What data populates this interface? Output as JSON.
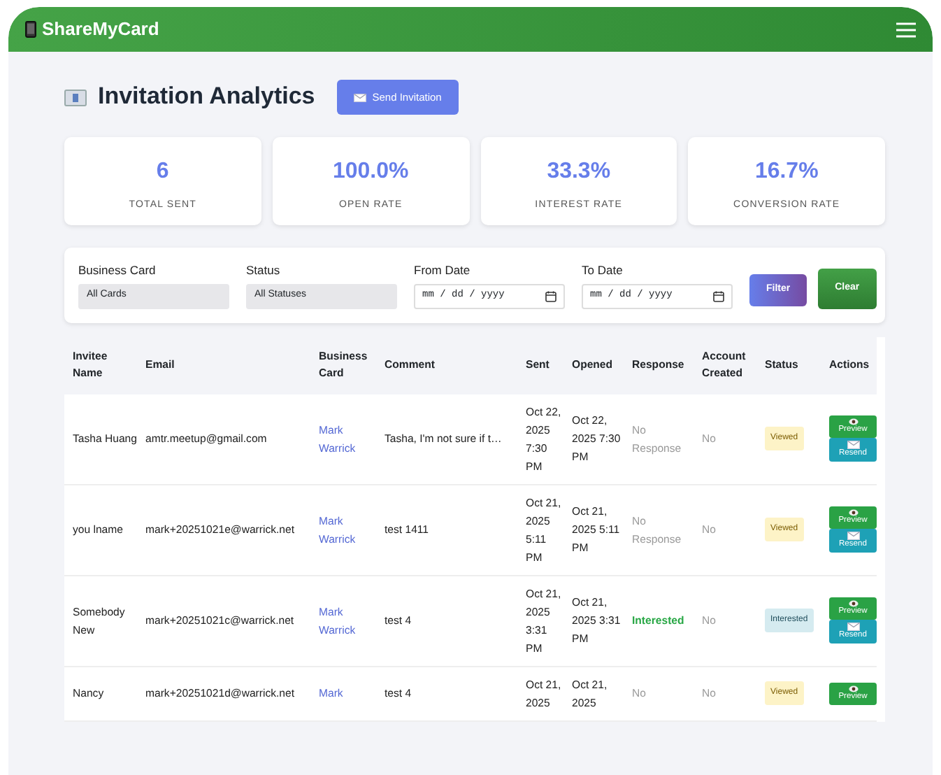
{
  "navbar": {
    "brand": "ShareMyCard"
  },
  "header": {
    "title": "Invitation Analytics",
    "button": "Send Invitation"
  },
  "stats": [
    {
      "value": "6",
      "label": "TOTAL SENT"
    },
    {
      "value": "100.0%",
      "label": "OPEN RATE"
    },
    {
      "value": "33.3%",
      "label": "INTEREST RATE"
    },
    {
      "value": "16.7%",
      "label": "CONVERSION RATE"
    }
  ],
  "filters": [
    {
      "kind": "select",
      "label": "Business Card",
      "value": "All Cards"
    },
    {
      "kind": "select",
      "label": "Status",
      "value": "All Statuses"
    },
    {
      "kind": "date",
      "label": "From Date",
      "placeholder": "mm / dd / yyyy"
    },
    {
      "kind": "date",
      "label": "To Date",
      "placeholder": "mm / dd / yyyy"
    }
  ],
  "filter_buttons": [
    "Filter",
    "Clear"
  ],
  "table": {
    "columns": [
      "Invitee Name",
      "Email",
      "Business Card",
      "Comment",
      "Sent",
      "Opened",
      "Response",
      "Account Created",
      "Status",
      "Actions"
    ],
    "rows": [
      {
        "name": "Tasha Huang",
        "email": "amtr.meetup@gmail.com",
        "card": "Mark Warrick",
        "comment": "Tasha, I'm not sure if t…",
        "sent": "Oct 22, 2025 7:30 PM",
        "opened": "Oct 22, 2025 7:30 PM",
        "response": {
          "kind": "none",
          "text": "No Response"
        },
        "account": "No",
        "status": {
          "kind": "viewed",
          "text": "Viewed"
        },
        "actions": [
          "Preview",
          "Resend"
        ]
      },
      {
        "name": "you lname",
        "email": "mark+20251021e@warrick.net",
        "card": "Mark Warrick",
        "comment": "test 1411",
        "sent": "Oct 21, 2025 5:11 PM",
        "opened": "Oct 21, 2025 5:11 PM",
        "response": {
          "kind": "none",
          "text": "No Response"
        },
        "account": "No",
        "status": {
          "kind": "viewed",
          "text": "Viewed"
        },
        "actions": [
          "Preview",
          "Resend"
        ]
      },
      {
        "name": "Somebody New",
        "email": "mark+20251021c@warrick.net",
        "card": "Mark Warrick",
        "comment": "test 4",
        "sent": "Oct 21, 2025 3:31 PM",
        "opened": "Oct 21, 2025 3:31 PM",
        "response": {
          "kind": "interested",
          "text": "Interested"
        },
        "account": "No",
        "status": {
          "kind": "interested",
          "text": "Interested"
        },
        "actions": [
          "Preview",
          "Resend"
        ]
      },
      {
        "name": "Nancy",
        "email": "mark+20251021d@warrick.net",
        "card": "Mark",
        "comment": "test 4",
        "sent": "Oct 21, 2025",
        "opened": "Oct 21, 2025",
        "response": {
          "kind": "none",
          "text": "No"
        },
        "account": "No",
        "status": {
          "kind": "viewed",
          "text": "Viewed"
        },
        "actions": [
          "Preview"
        ]
      }
    ]
  }
}
